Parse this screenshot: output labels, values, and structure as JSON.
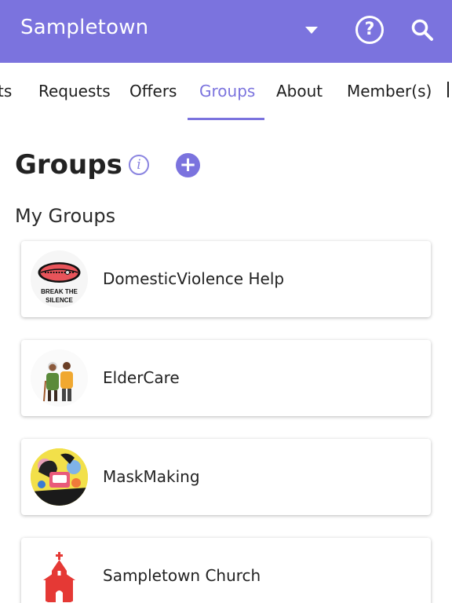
{
  "appbar": {
    "title": "Sampletown",
    "color": "#7b73de",
    "help_icon": "question-circle-icon",
    "search_icon": "magnifier-icon"
  },
  "tabs": [
    {
      "label": "ts",
      "active": false
    },
    {
      "label": "Requests",
      "active": false
    },
    {
      "label": "Offers",
      "active": false
    },
    {
      "label": "Groups",
      "active": true
    },
    {
      "label": "About",
      "active": false
    },
    {
      "label": "Member(s)",
      "active": false
    }
  ],
  "main": {
    "title": "Groups",
    "info_icon": "info-icon",
    "add_icon": "plus-circle-icon",
    "section_title": "My Groups"
  },
  "groups": [
    {
      "name": "DomesticViolence Help",
      "avatar": "break-the-silence-logo",
      "avatar_text": [
        "BREAK THE",
        "SILENCE"
      ]
    },
    {
      "name": "ElderCare",
      "avatar": "elderly-couple-illustration"
    },
    {
      "name": "MaskMaking",
      "avatar": "mask-making-illustration"
    },
    {
      "name": "Sampletown Church",
      "avatar": "church-icon"
    }
  ]
}
